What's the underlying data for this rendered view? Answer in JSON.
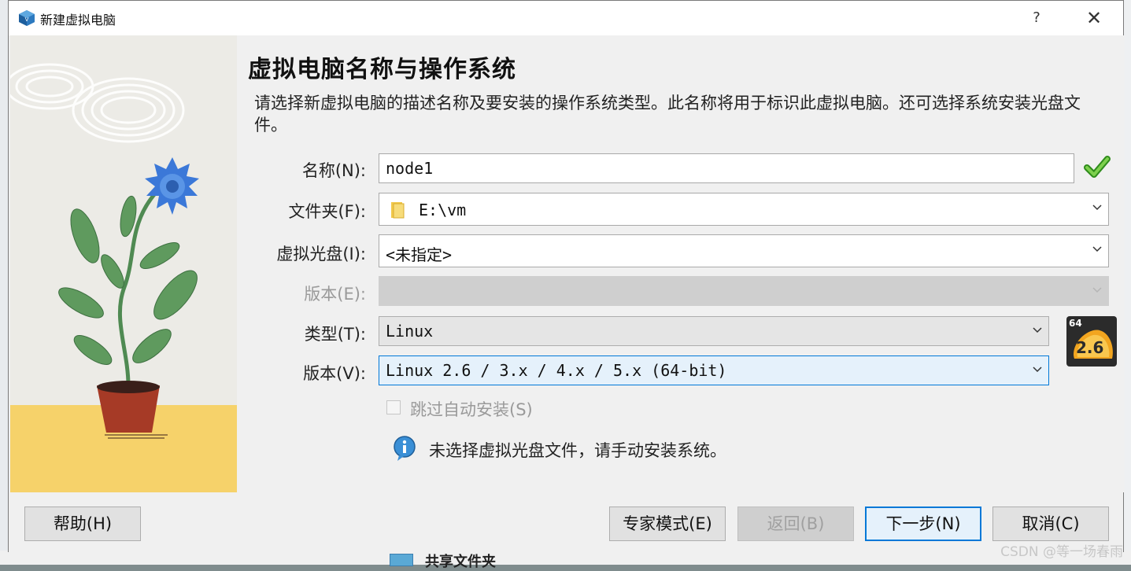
{
  "window": {
    "title": "新建虚拟电脑",
    "help_button": "?",
    "close_button": "✕"
  },
  "page": {
    "heading": "虚拟电脑名称与操作系统",
    "description": "请选择新虚拟电脑的描述名称及要安装的操作系统类型。此名称将用于标识此虚拟电脑。还可选择系统安装光盘文件。"
  },
  "form": {
    "name": {
      "label": "名称(N):",
      "value": "node1",
      "valid": true
    },
    "folder": {
      "label": "文件夹(F):",
      "value": "E:\\vm"
    },
    "iso": {
      "label": "虚拟光盘(I):",
      "value": "<未指定>"
    },
    "edition": {
      "label": "版本(E):",
      "value": "",
      "disabled": true
    },
    "type": {
      "label": "类型(T):",
      "value": "Linux"
    },
    "version": {
      "label": "版本(V):",
      "value": "Linux 2.6 / 3.x / 4.x / 5.x (64-bit)"
    },
    "os_icon": {
      "bits": "64",
      "version": "2.6"
    },
    "skip_unattended": {
      "label": "跳过自动安装(S)",
      "checked": false,
      "disabled": true
    },
    "info_message": "未选择虚拟光盘文件，请手动安装系统。"
  },
  "footer": {
    "help": "帮助(H)",
    "expert": "专家模式(E)",
    "back": "返回(B)",
    "next": "下一步(N)",
    "cancel": "取消(C)"
  },
  "background": {
    "peek_text": "共享文件夹",
    "watermark": "CSDN @等一场春雨"
  },
  "colors": {
    "accent": "#0078d7",
    "check_green": "#4caf2a",
    "flower_blue": "#3b78d8",
    "leaf_green": "#5f9a5e",
    "pot_red": "#a63a26",
    "ground_yellow": "#f6d26a"
  }
}
